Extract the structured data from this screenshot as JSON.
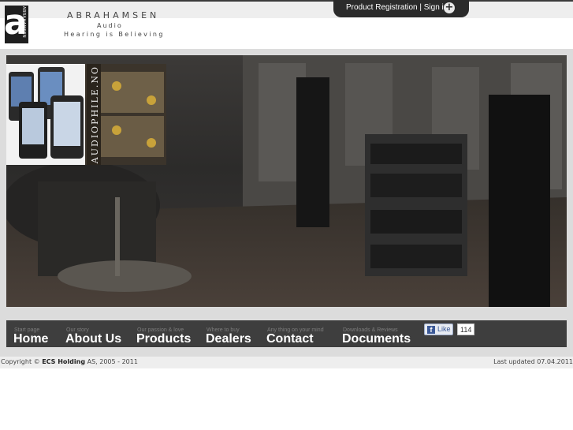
{
  "topbar": {
    "registration_link": "Product Registration | Sign in",
    "expand_icon": "plus-icon"
  },
  "logo": {
    "letter": "a",
    "vertical_text": "ABRAHAMSEN",
    "brand": "ABRAHAMSEN",
    "subtitle": "Audio",
    "slogan": "Hearing is Believing"
  },
  "hero": {
    "promo_text": "AUDIOPHILE.NO"
  },
  "nav": {
    "items": [
      {
        "sub": "Start page",
        "label": "Home"
      },
      {
        "sub": "Our story",
        "label": "About Us"
      },
      {
        "sub": "Our passion & love",
        "label": "Products"
      },
      {
        "sub": "Where to buy",
        "label": "Dealers"
      },
      {
        "sub": "Any thing on your mind",
        "label": "Contact"
      },
      {
        "sub": "Downloads & Reviews",
        "label": "Documents"
      }
    ],
    "facebook": {
      "like_label": "Like",
      "count": "114",
      "brand_letter": "f"
    }
  },
  "footer": {
    "copyright_prefix": "Copyright ©",
    "company": "ECS Holding",
    "copyright_suffix": "AS, 2005 - 2011",
    "last_updated": "Last updated 07.04.2011"
  },
  "colors": {
    "nav_bg": "#3e3e3e",
    "topbar_tab": "#2b2b2b",
    "facebook_blue": "#3b5998"
  }
}
